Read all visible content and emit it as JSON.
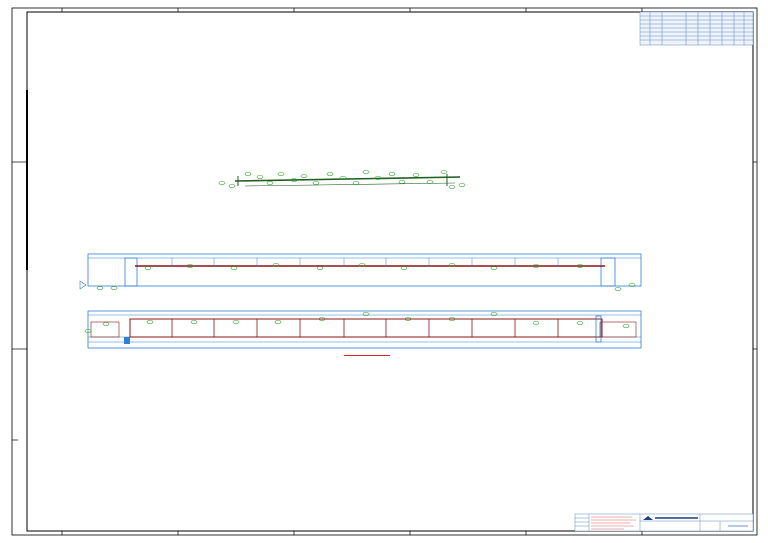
{
  "sheet": {
    "border_color": "#000000",
    "background": "#ffffff"
  },
  "drawing": {
    "plan_color": "#1f5f1f",
    "elevation_outline_color": "#2f7fd8",
    "beam_color": "#8b1414",
    "tag_color": "#22a022",
    "caption_color": "#dd2222"
  },
  "colors": {
    "border_ticks": "#000000",
    "title_block": "#3a6fb0"
  },
  "icons": {
    "section_marker": "triangle-marker-icon",
    "firm_logo": "logo-icon"
  }
}
